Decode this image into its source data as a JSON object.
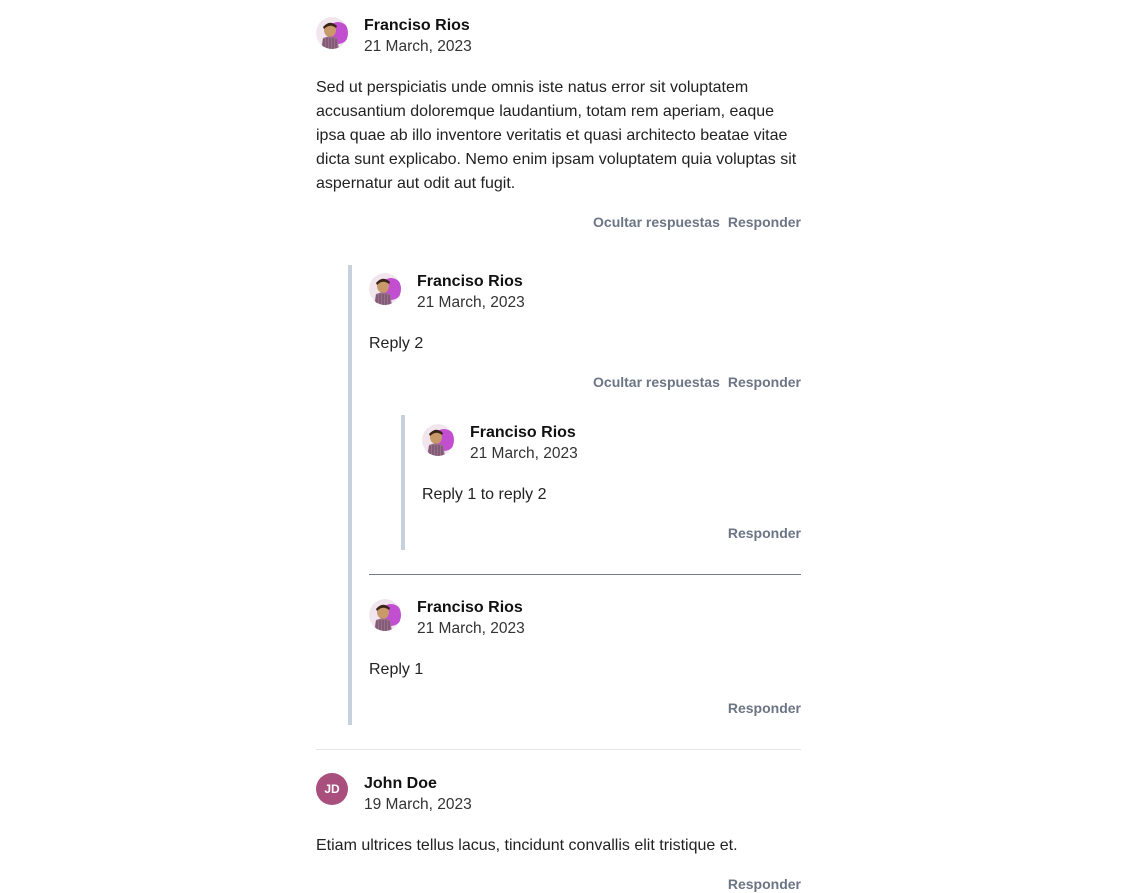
{
  "comments": [
    {
      "author": "Franciso Rios",
      "date": "21 March, 2023",
      "text": "Sed ut perspiciatis unde omnis iste natus error sit voluptatem accusantium doloremque laudantium, totam rem aperiam, eaque ipsa quae ab illo inventore veritatis et quasi architecto beatae vitae dicta sunt explicabo. Nemo enim ipsam voluptatem quia voluptas sit aspernatur aut odit aut fugit.",
      "hide_label": "Ocultar respuestas",
      "reply_label": "Responder",
      "replies": [
        {
          "author": "Franciso Rios",
          "date": "21 March, 2023",
          "text": "Reply 2",
          "hide_label": "Ocultar respuestas",
          "reply_label": "Responder",
          "replies": [
            {
              "author": "Franciso Rios",
              "date": "21 March, 2023",
              "text": "Reply 1 to reply 2",
              "reply_label": "Responder"
            }
          ]
        },
        {
          "author": "Franciso Rios",
          "date": "21 March, 2023",
          "text": "Reply 1",
          "reply_label": "Responder"
        }
      ]
    },
    {
      "author": "John Doe",
      "initials": "JD",
      "date": "19 March, 2023",
      "text": "Etiam ultrices tellus lacus, tincidunt convallis elit tristique et.",
      "reply_label": "Responder",
      "avatar_color": "#a84f7d"
    }
  ],
  "icons": {
    "photo_avatar": "user-photo-avatar-icon"
  }
}
